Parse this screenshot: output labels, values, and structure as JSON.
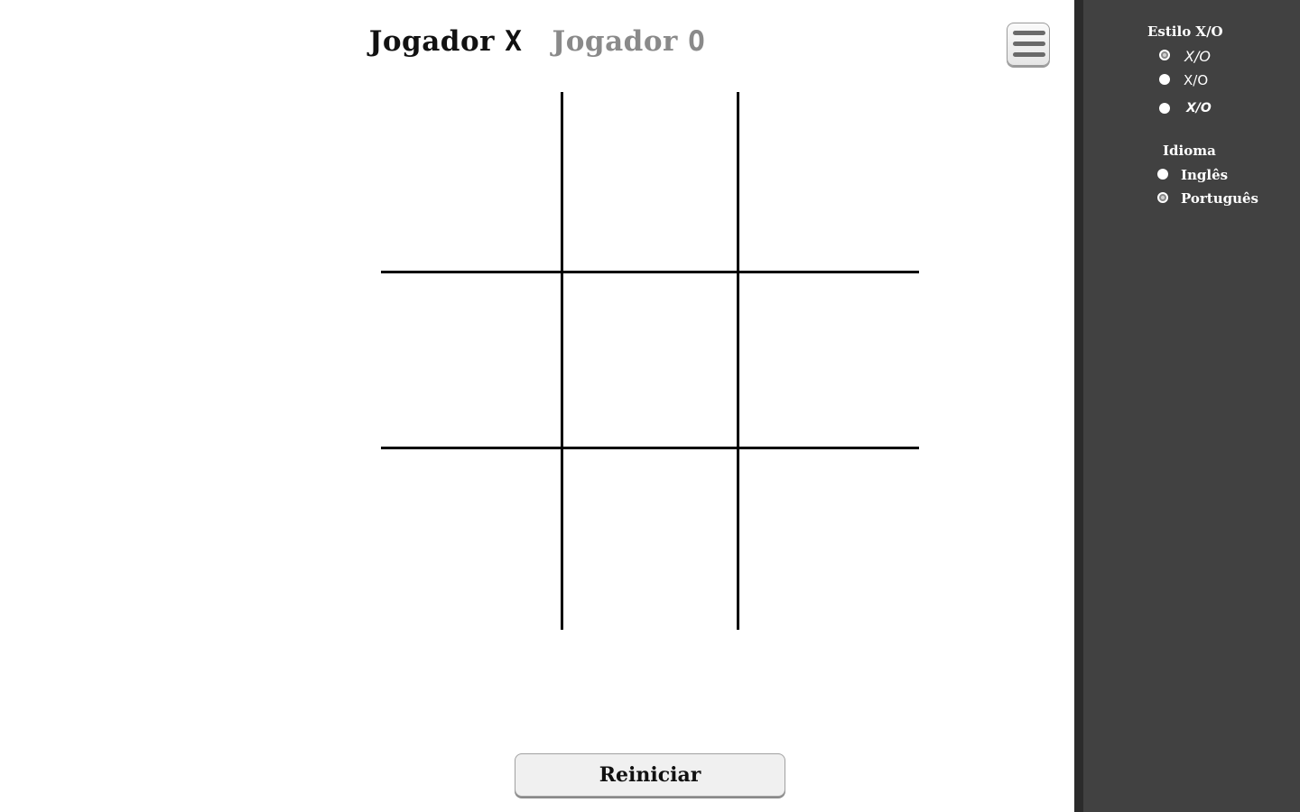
{
  "players": {
    "x": {
      "label": "Jogador",
      "mark": "X",
      "active": true
    },
    "o": {
      "label": "Jogador",
      "mark": "O",
      "active": false
    }
  },
  "menu": {
    "icon": "hamburger-menu-icon"
  },
  "board": {
    "cells": [
      "",
      "",
      "",
      "",
      "",
      "",
      "",
      "",
      ""
    ]
  },
  "restart": {
    "label": "Reiniciar"
  },
  "sidebar": {
    "style_section": {
      "title": "Estilo X/O",
      "options": [
        {
          "label": "X/O",
          "selected": true
        },
        {
          "label": "X/O",
          "selected": false
        },
        {
          "label": "X/O",
          "selected": false
        }
      ]
    },
    "language_section": {
      "title": "Idioma",
      "options": [
        {
          "label": "Inglês",
          "selected": false
        },
        {
          "label": "Português",
          "selected": true
        }
      ]
    }
  },
  "colors": {
    "sidebar_bg": "#414141",
    "sidebar_border": "#2b2b2b",
    "active_player": "#111111",
    "inactive_player": "#8a8a8a"
  }
}
